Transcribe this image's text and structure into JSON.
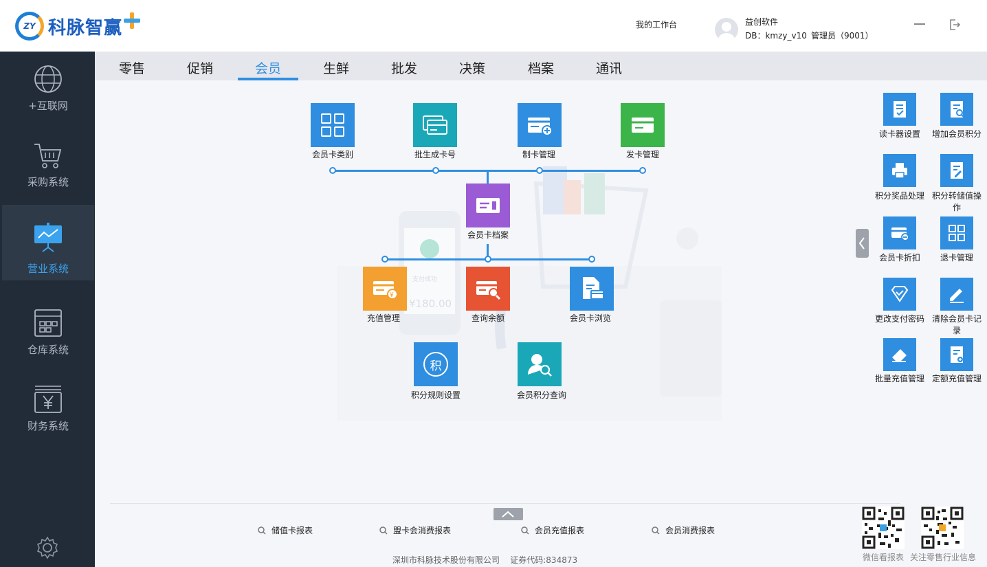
{
  "header": {
    "logo_badge": "ZY",
    "logo_text": "科脉智赢",
    "workbench": "我的工作台",
    "company": "益创软件",
    "db": "DB：kmzy_v10",
    "role": "管理员（9001）"
  },
  "sidebar": {
    "items": [
      {
        "label": "+互联网",
        "icon": "globe-icon"
      },
      {
        "label": "采购系统",
        "icon": "cart-icon"
      },
      {
        "label": "营业系统",
        "icon": "presentation-icon"
      },
      {
        "label": "仓库系统",
        "icon": "warehouse-icon"
      },
      {
        "label": "财务系统",
        "icon": "yen-icon"
      }
    ],
    "active_index": 2
  },
  "tabs": [
    {
      "label": "零售"
    },
    {
      "label": "促销"
    },
    {
      "label": "会员"
    },
    {
      "label": "生鲜"
    },
    {
      "label": "批发"
    },
    {
      "label": "决策"
    },
    {
      "label": "档案"
    },
    {
      "label": "通讯"
    }
  ],
  "active_tab": "会员",
  "illustration": {
    "amount": "¥180.00",
    "pay_text": "支付成功"
  },
  "flow": {
    "card_type": {
      "label": "会员卡类别",
      "color": "#2f8ee0"
    },
    "batch_card": {
      "label": "批生成卡号",
      "color": "#1aa8b8"
    },
    "make_card": {
      "label": "制卡管理",
      "color": "#2f8ee0"
    },
    "issue_card": {
      "label": "发卡管理",
      "color": "#3bb54a"
    },
    "card_archive": {
      "label": "会员卡档案",
      "color": "#9b5bd4"
    },
    "recharge": {
      "label": "充值管理",
      "color": "#f4a030"
    },
    "balance": {
      "label": "查询余额",
      "color": "#e65433"
    },
    "card_browse": {
      "label": "会员卡浏览",
      "color": "#2f8ee0"
    },
    "points_rule": {
      "label": "积分规则设置",
      "color": "#2f8ee0",
      "glyph": "积"
    },
    "points_query": {
      "label": "会员积分查询",
      "color": "#1aa8b8"
    }
  },
  "right_panel": {
    "items": [
      {
        "label": "读卡器设置",
        "icon": "doc-check-icon"
      },
      {
        "label": "增加会员积分",
        "icon": "doc-search-icon"
      },
      {
        "label": "积分奖品处理",
        "icon": "printer-icon"
      },
      {
        "label": "积分转储值操作",
        "icon": "doc-edit-icon"
      },
      {
        "label": "会员卡折扣",
        "icon": "card-minus-icon"
      },
      {
        "label": "退卡管理",
        "icon": "grid-icon"
      },
      {
        "label": "更改支付密码",
        "icon": "diamond-check-icon"
      },
      {
        "label": "清除会员卡记录",
        "icon": "pencil-icon"
      },
      {
        "label": "批量充值管理",
        "icon": "eraser-icon"
      },
      {
        "label": "定额充值管理",
        "icon": "doc-plus-icon"
      }
    ]
  },
  "reports": [
    {
      "label": "储值卡报表"
    },
    {
      "label": "盟卡会消费报表"
    },
    {
      "label": "会员充值报表"
    },
    {
      "label": "会员消费报表"
    }
  ],
  "footer": {
    "company": "深圳市科脉技术股份有限公司    证券代码:834873",
    "qr1_label": "微信看报表",
    "qr2_label": "关注零售行业信息"
  }
}
